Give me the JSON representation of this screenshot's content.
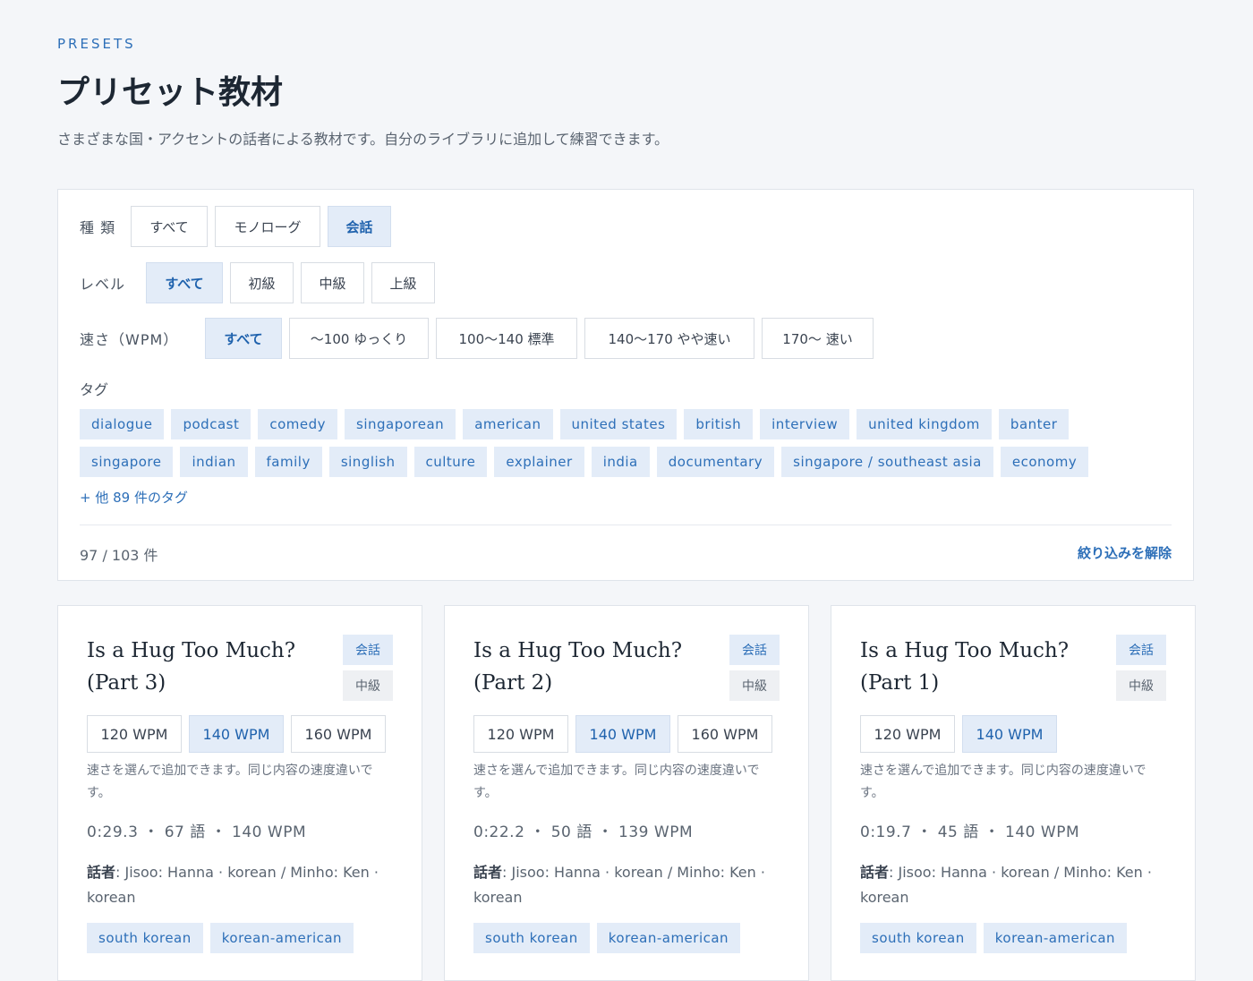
{
  "header": {
    "eyebrow": "PRESETS",
    "title": "プリセット教材",
    "subtitle": "さまざまな国・アクセントの話者による教材です。自分のライブラリに追加して練習できます。"
  },
  "filters": {
    "type": {
      "label": "種 類",
      "options": [
        "すべて",
        "モノローグ",
        "会話"
      ],
      "selected": "会話"
    },
    "level": {
      "label": "レベル",
      "options": [
        "すべて",
        "初級",
        "中級",
        "上級"
      ],
      "selected": "すべて"
    },
    "speed": {
      "label": "速さ（WPM）",
      "options": [
        "すべて",
        "〜100 ゆっくり",
        "100〜140 標準",
        "140〜170 やや速い",
        "170〜 速い"
      ],
      "selected": "すべて"
    },
    "tags_label": "タグ",
    "tags_row1": [
      "dialogue",
      "podcast",
      "comedy",
      "singaporean",
      "american",
      "united states",
      "british",
      "interview",
      "united kingdom",
      "banter"
    ],
    "tags_row2": [
      "singapore",
      "indian",
      "family",
      "singlish",
      "culture",
      "explainer",
      "india",
      "documentary",
      "singapore / southeast asia",
      "economy"
    ],
    "more_tags": "+ 他 89 件のタグ",
    "result_count": "97 / 103 件",
    "clear": "絞り込みを解除"
  },
  "cards": [
    {
      "title": "Is a Hug Too Much? (Part 3)",
      "type": "会話",
      "level": "中級",
      "speeds": [
        "120 WPM",
        "140 WPM",
        "160 WPM"
      ],
      "selected_speed": "140 WPM",
      "hint": "速さを選んで追加できます。同じ内容の速度違いです。",
      "stats": "0:29.3 ・ 67 語 ・ 140 WPM",
      "speaker_label": "話者",
      "speakers": ": Jisoo: Hanna · korean / Minho: Ken · korean",
      "tags": [
        "south korean",
        "korean-american"
      ]
    },
    {
      "title": "Is a Hug Too Much? (Part 2)",
      "type": "会話",
      "level": "中級",
      "speeds": [
        "120 WPM",
        "140 WPM",
        "160 WPM"
      ],
      "selected_speed": "140 WPM",
      "hint": "速さを選んで追加できます。同じ内容の速度違いです。",
      "stats": "0:22.2 ・ 50 語 ・ 139 WPM",
      "speaker_label": "話者",
      "speakers": ": Jisoo: Hanna · korean / Minho: Ken · korean",
      "tags": [
        "south korean",
        "korean-american"
      ]
    },
    {
      "title": "Is a Hug Too Much? (Part 1)",
      "type": "会話",
      "level": "中級",
      "speeds": [
        "120 WPM",
        "140 WPM"
      ],
      "selected_speed": "140 WPM",
      "hint": "速さを選んで追加できます。同じ内容の速度違いです。",
      "stats": "0:19.7 ・ 45 語 ・ 140 WPM",
      "speaker_label": "話者",
      "speakers": ": Jisoo: Hanna · korean / Minho: Ken · korean",
      "tags": [
        "south korean",
        "korean-american"
      ]
    }
  ]
}
